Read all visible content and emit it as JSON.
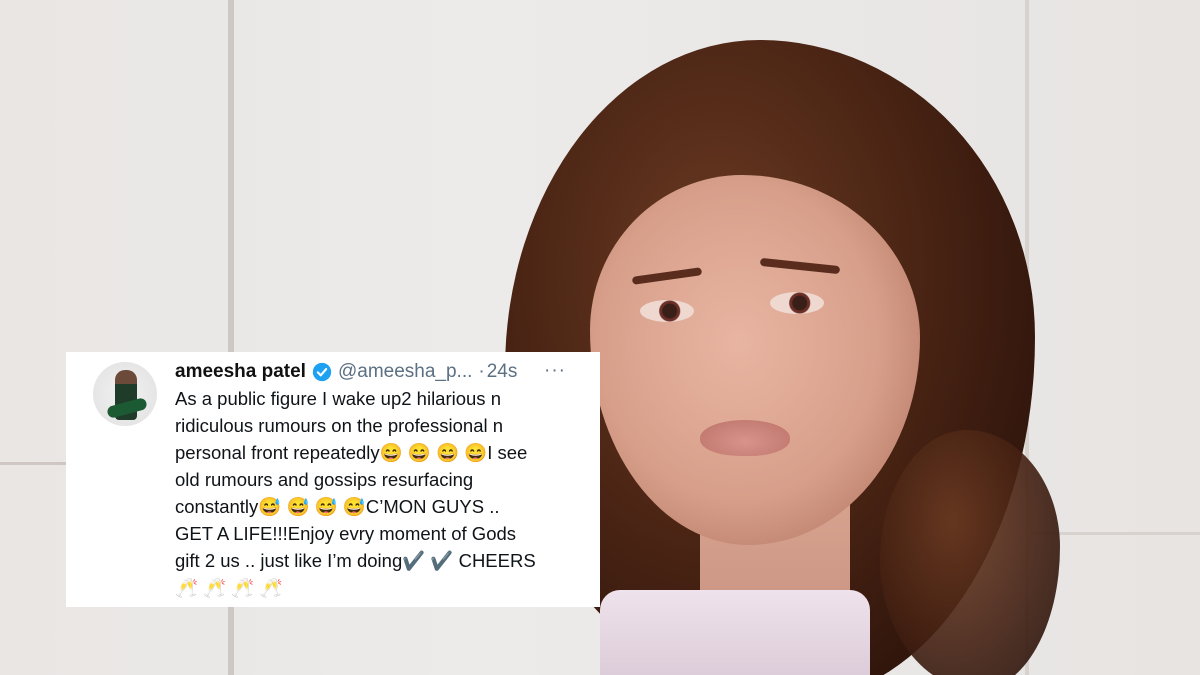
{
  "tweet": {
    "display_name": "ameesha patel",
    "handle": "@ameesha_p...",
    "separator": "·",
    "time": "24s",
    "more": "···",
    "lines": [
      "As a public figure I wake up2 hilarious n",
      "ridiculous rumours on the professional n",
      "personal front repeatedly😄 😄 😄 😄I see",
      "old rumours and gossips resurfacing",
      "constantly😅 😅 😅 😅C’MON GUYS ..",
      "GET A LIFE!!!Enjoy evry moment of Gods",
      "gift 2 us .. just like I’m doing✔️ ✔️ CHEERS",
      "🥂 🥂 🥂 🥂"
    ]
  },
  "colors": {
    "verified": "#1da1f2",
    "secondary_text": "#5b7083",
    "primary_text": "#0f1419"
  },
  "icons": {
    "verified": "verified-badge-icon",
    "more": "more-icon"
  }
}
